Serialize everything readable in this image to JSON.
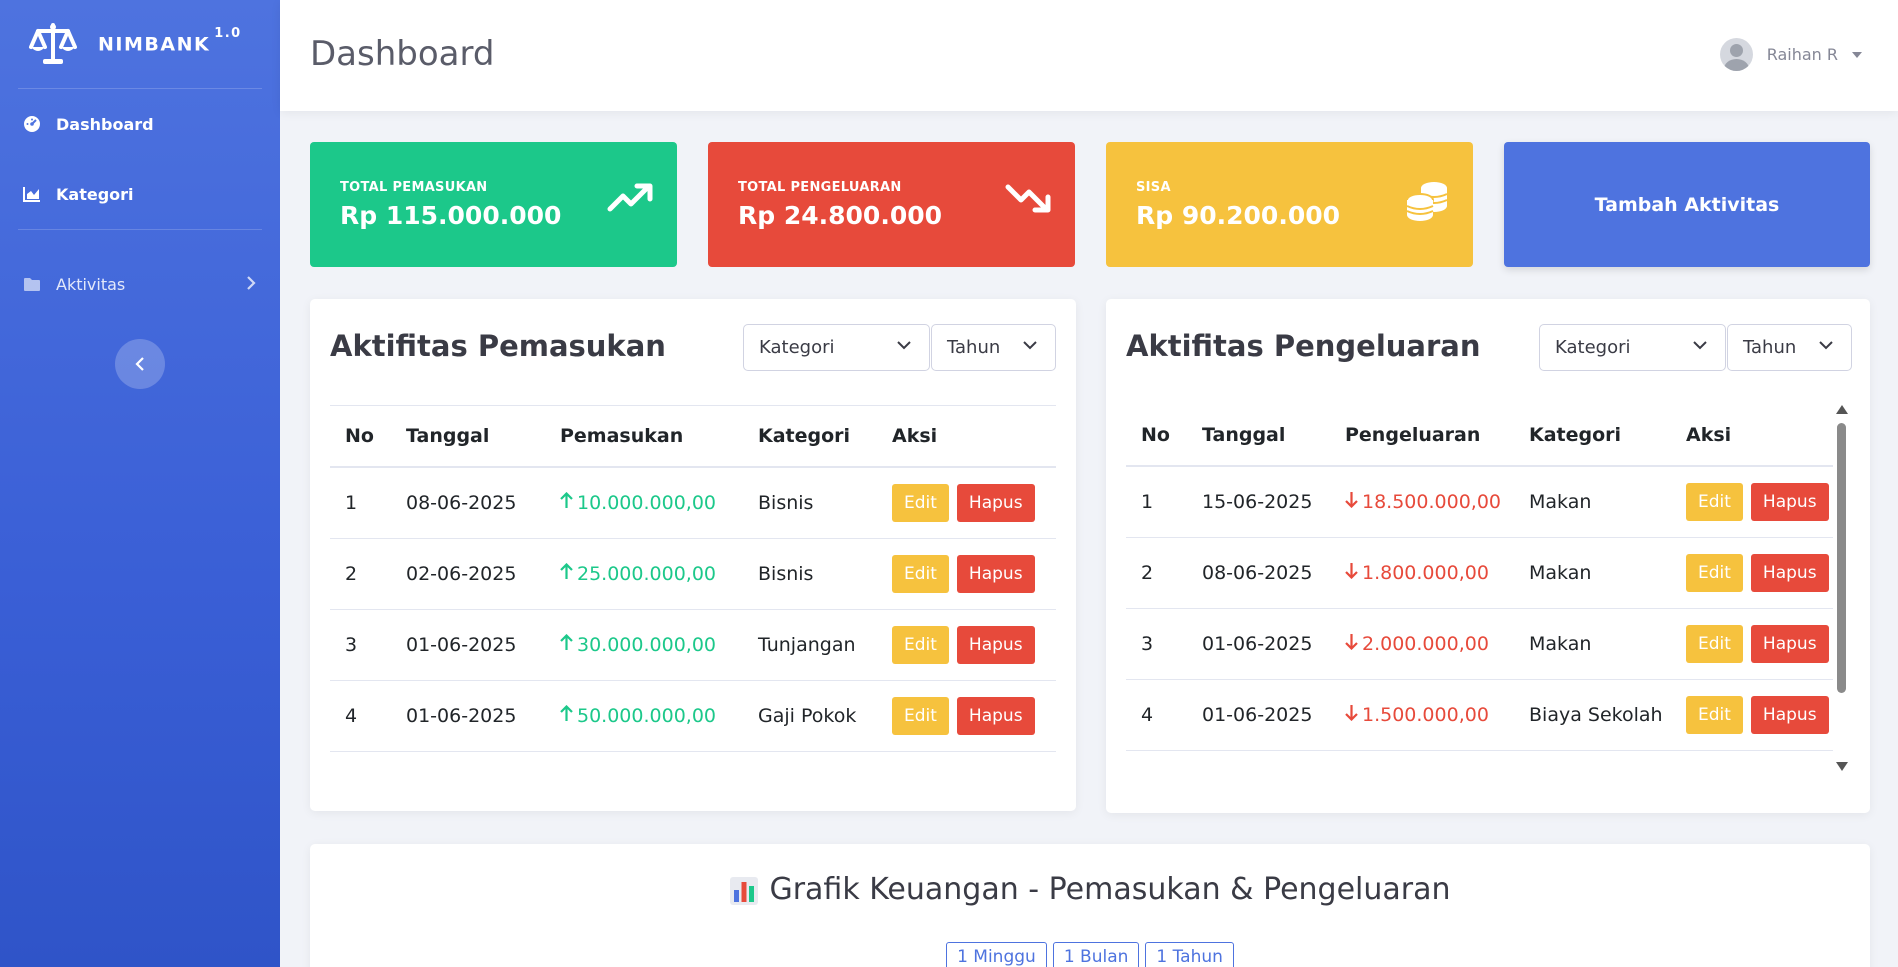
{
  "brand": {
    "name": "NIMBANK",
    "version": "1.0"
  },
  "sidebar": {
    "items": [
      {
        "label": "Dashboard",
        "icon": "gauge-icon"
      },
      {
        "label": "Kategori",
        "icon": "chart-area-icon"
      },
      {
        "label": "Aktivitas",
        "icon": "folder-icon"
      }
    ]
  },
  "topbar": {
    "title": "Dashboard",
    "user_name": "Raihan R"
  },
  "stats": {
    "income": {
      "label": "TOTAL PEMASUKAN",
      "value": "Rp 115.000.000",
      "color": "#1cc88a"
    },
    "expense": {
      "label": "TOTAL PENGELUARAN",
      "value": "Rp 24.800.000",
      "color": "#e74a3b"
    },
    "balance": {
      "label": "SISA",
      "value": "Rp 90.200.000",
      "color": "#f6c23e"
    },
    "add_button": "Tambah Aktivitas"
  },
  "income_card": {
    "title": "Aktifitas Pemasukan",
    "filter_category": "Kategori",
    "filter_year": "Tahun",
    "headers": [
      "No",
      "Tanggal",
      "Pemasukan",
      "Kategori",
      "Aksi"
    ],
    "rows": [
      {
        "no": "1",
        "date": "08-06-2025",
        "amount": "10.000.000,00",
        "category": "Bisnis"
      },
      {
        "no": "2",
        "date": "02-06-2025",
        "amount": "25.000.000,00",
        "category": "Bisnis"
      },
      {
        "no": "3",
        "date": "01-06-2025",
        "amount": "30.000.000,00",
        "category": "Tunjangan"
      },
      {
        "no": "4",
        "date": "01-06-2025",
        "amount": "50.000.000,00",
        "category": "Gaji Pokok"
      }
    ]
  },
  "expense_card": {
    "title": "Aktifitas Pengeluaran",
    "filter_category": "Kategori",
    "filter_year": "Tahun",
    "headers": [
      "No",
      "Tanggal",
      "Pengeluaran",
      "Kategori",
      "Aksi"
    ],
    "rows": [
      {
        "no": "1",
        "date": "15-06-2025",
        "amount": "18.500.000,00",
        "category": "Makan"
      },
      {
        "no": "2",
        "date": "08-06-2025",
        "amount": "1.800.000,00",
        "category": "Makan"
      },
      {
        "no": "3",
        "date": "01-06-2025",
        "amount": "2.000.000,00",
        "category": "Makan"
      },
      {
        "no": "4",
        "date": "01-06-2025",
        "amount": "1.500.000,00",
        "category": "Biaya Sekolah"
      }
    ]
  },
  "actions": {
    "edit": "Edit",
    "delete": "Hapus"
  },
  "chart_section": {
    "title": "Grafik Keuangan - Pemasukan & Pengeluaran",
    "ranges": [
      "1 Minggu",
      "1 Bulan",
      "1 Tahun"
    ]
  }
}
